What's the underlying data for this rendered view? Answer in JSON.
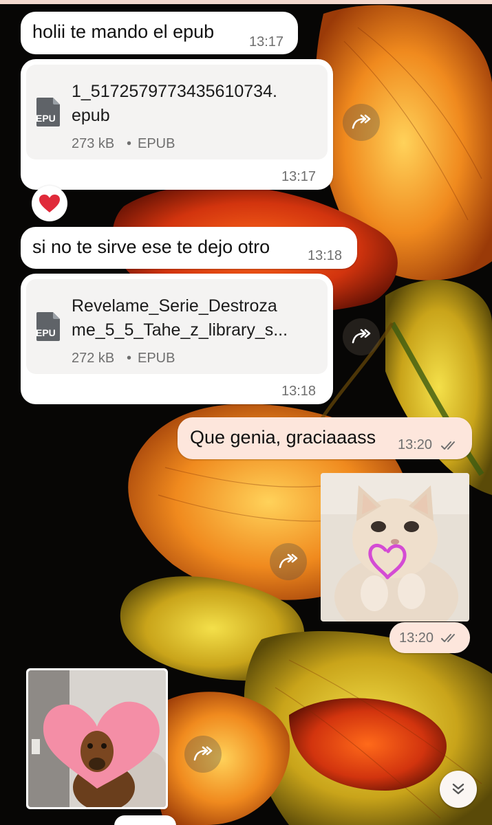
{
  "messages": [
    {
      "id": "m1",
      "direction": "incoming",
      "type": "text",
      "text": "holii te mando el epub",
      "time": "13:17"
    },
    {
      "id": "m2",
      "direction": "incoming",
      "type": "file",
      "file": {
        "name_line1": "1_5172579773435610734.",
        "name_line2": "epub",
        "size": "273 kB",
        "sep": "•",
        "format": "EPUB",
        "icon_label": "EPU"
      },
      "time": "13:17",
      "reaction": "❤️"
    },
    {
      "id": "m3",
      "direction": "incoming",
      "type": "text",
      "text": "si no te sirve ese te dejo otro",
      "time": "13:18"
    },
    {
      "id": "m4",
      "direction": "incoming",
      "type": "file",
      "file": {
        "name_line1": "Revelame_Serie_Destroza",
        "name_line2": "me_5_5_Tahe_z_library_s...",
        "size": "272 kB",
        "sep": "•",
        "format": "EPUB",
        "icon_label": "EPU"
      },
      "time": "13:18"
    },
    {
      "id": "m5",
      "direction": "outgoing",
      "type": "text",
      "text": "Que genia, graciaaass",
      "time": "13:20",
      "status": "read"
    },
    {
      "id": "m6",
      "direction": "outgoing",
      "type": "sticker",
      "sticker": "kitten-with-heart",
      "time": "13:20",
      "status": "read"
    },
    {
      "id": "m7",
      "direction": "incoming",
      "type": "image",
      "image": "dog-with-heart-cutout"
    }
  ],
  "icons": {
    "forward": "forward-icon",
    "read_receipt": "double-check-icon",
    "scroll_down": "chevron-double-down-icon",
    "file": "epub-file-icon"
  },
  "colors": {
    "incoming_bubble": "#ffffff",
    "outgoing_bubble": "#fde6dc",
    "file_card": "#f4f3f2",
    "meta_text": "#6f6f6f",
    "reaction_heart": "#e02a3a"
  }
}
